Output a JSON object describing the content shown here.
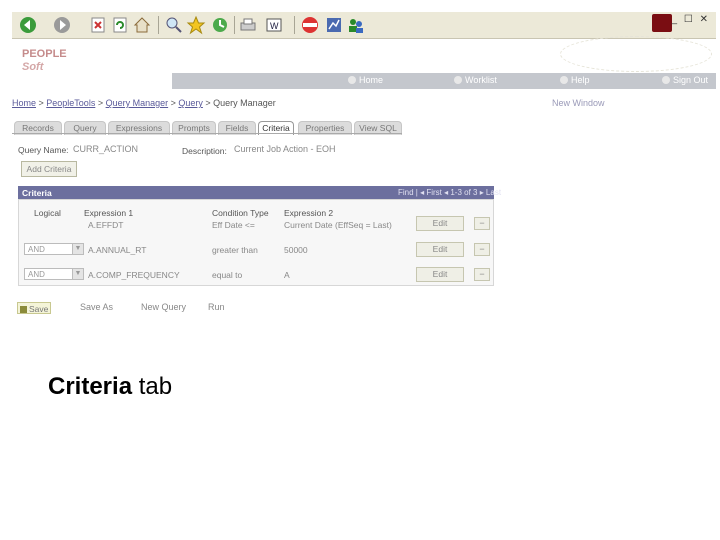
{
  "window": {
    "controls": "_ ☐ ✕"
  },
  "header": {
    "logo_line1": "PEOPLE",
    "logo_line2": "Soft",
    "nav": [
      "Home",
      "Worklist",
      "Help",
      "Sign Out"
    ]
  },
  "breadcrumb": {
    "items": [
      "Home",
      "PeopleTools",
      "Query Manager",
      "Query"
    ],
    "current": "Query Manager",
    "new_window": "New Window"
  },
  "tabs": [
    "Records",
    "Query",
    "Expressions",
    "Prompts",
    "Fields",
    "Criteria",
    "Properties",
    "View SQL"
  ],
  "query": {
    "name_label": "Query Name:",
    "name_value": "CURR_ACTION",
    "desc_label": "Description:",
    "desc_value": "Current Job Action - EOH",
    "add_criteria": "Add Criteria"
  },
  "grid": {
    "title": "Criteria",
    "nav": "Find | ◂ First ◂ 1-3 of 3 ▸ Last",
    "headers": [
      "Logical",
      "Expression 1",
      "Condition Type",
      "Expression 2"
    ],
    "rows": [
      {
        "logical": "",
        "expr1": "A.EFFDT",
        "cond": "Eff Date <=",
        "expr2": "Current Date (EffSeq = Last)"
      },
      {
        "logical": "AND",
        "expr1": "A.ANNUAL_RT",
        "cond": "greater than",
        "expr2": "50000"
      },
      {
        "logical": "AND",
        "expr1": "A.COMP_FREQUENCY",
        "cond": "equal to",
        "expr2": "A"
      }
    ],
    "edit_label": "Edit",
    "remove_label": "−"
  },
  "actions": {
    "save": "Save",
    "save_as": "Save As",
    "new_query": "New Query",
    "run": "Run"
  },
  "caption": {
    "bold": "Criteria",
    "rest": " tab"
  },
  "colors": {
    "grid_header": "#6c6f9e",
    "nav_bar": "#c4c7cd"
  }
}
